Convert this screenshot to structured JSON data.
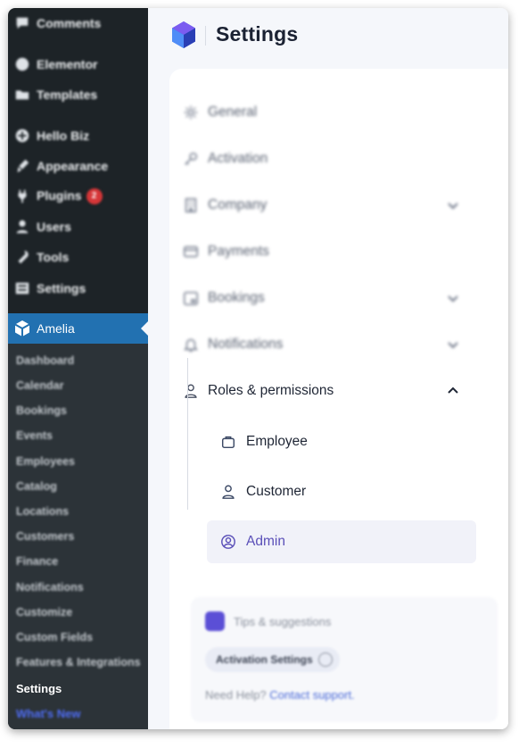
{
  "wp_menu": {
    "top_items": [
      {
        "label": "Comments",
        "icon": "comment-icon"
      },
      {
        "label": "Elementor",
        "icon": "elementor-icon"
      },
      {
        "label": "Templates",
        "icon": "folder-icon"
      },
      {
        "label": "Hello Biz",
        "icon": "plus-circle-icon"
      },
      {
        "label": "Appearance",
        "icon": "brush-icon"
      },
      {
        "label": "Plugins",
        "icon": "plug-icon",
        "badge": "2"
      },
      {
        "label": "Users",
        "icon": "user-icon"
      },
      {
        "label": "Tools",
        "icon": "wrench-icon"
      },
      {
        "label": "Settings",
        "icon": "sliders-icon"
      }
    ],
    "amelia": {
      "label": "Amelia",
      "icon": "amelia-logo-icon"
    },
    "amelia_submenu": [
      "Dashboard",
      "Calendar",
      "Bookings",
      "Events",
      "Employees",
      "Catalog",
      "Locations",
      "Customers",
      "Finance",
      "Notifications",
      "Customize",
      "Custom Fields",
      "Features & Integrations"
    ],
    "current": "Settings",
    "whats_new": "What's New"
  },
  "header": {
    "title": "Settings"
  },
  "settings_nav": [
    {
      "label": "General",
      "icon": "gear-icon",
      "chevron": false
    },
    {
      "label": "Activation",
      "icon": "key-icon",
      "chevron": false
    },
    {
      "label": "Company",
      "icon": "building-icon",
      "chevron": "down"
    },
    {
      "label": "Payments",
      "icon": "card-icon",
      "chevron": false
    },
    {
      "label": "Bookings",
      "icon": "calendar-icon",
      "chevron": "down"
    },
    {
      "label": "Notifications",
      "icon": "bell-icon",
      "chevron": "down"
    },
    {
      "label": "Roles & permissions",
      "icon": "person-icon",
      "chevron": "up"
    }
  ],
  "roles_submenu": [
    {
      "label": "Employee",
      "icon": "briefcase-icon",
      "active": false
    },
    {
      "label": "Customer",
      "icon": "person-icon",
      "active": false
    },
    {
      "label": "Admin",
      "icon": "user-circle-icon",
      "active": true
    }
  ],
  "tips": {
    "title": "Tips & suggestions",
    "chip": "Activation Settings",
    "help_text": "Need Help?",
    "help_link": "Contact support."
  },
  "colors": {
    "wp_sidebar": "#1d2327",
    "wp_submenu": "#2c3338",
    "wp_active": "#2271b1",
    "accent": "#5a4fb8",
    "badge": "#d63638"
  }
}
